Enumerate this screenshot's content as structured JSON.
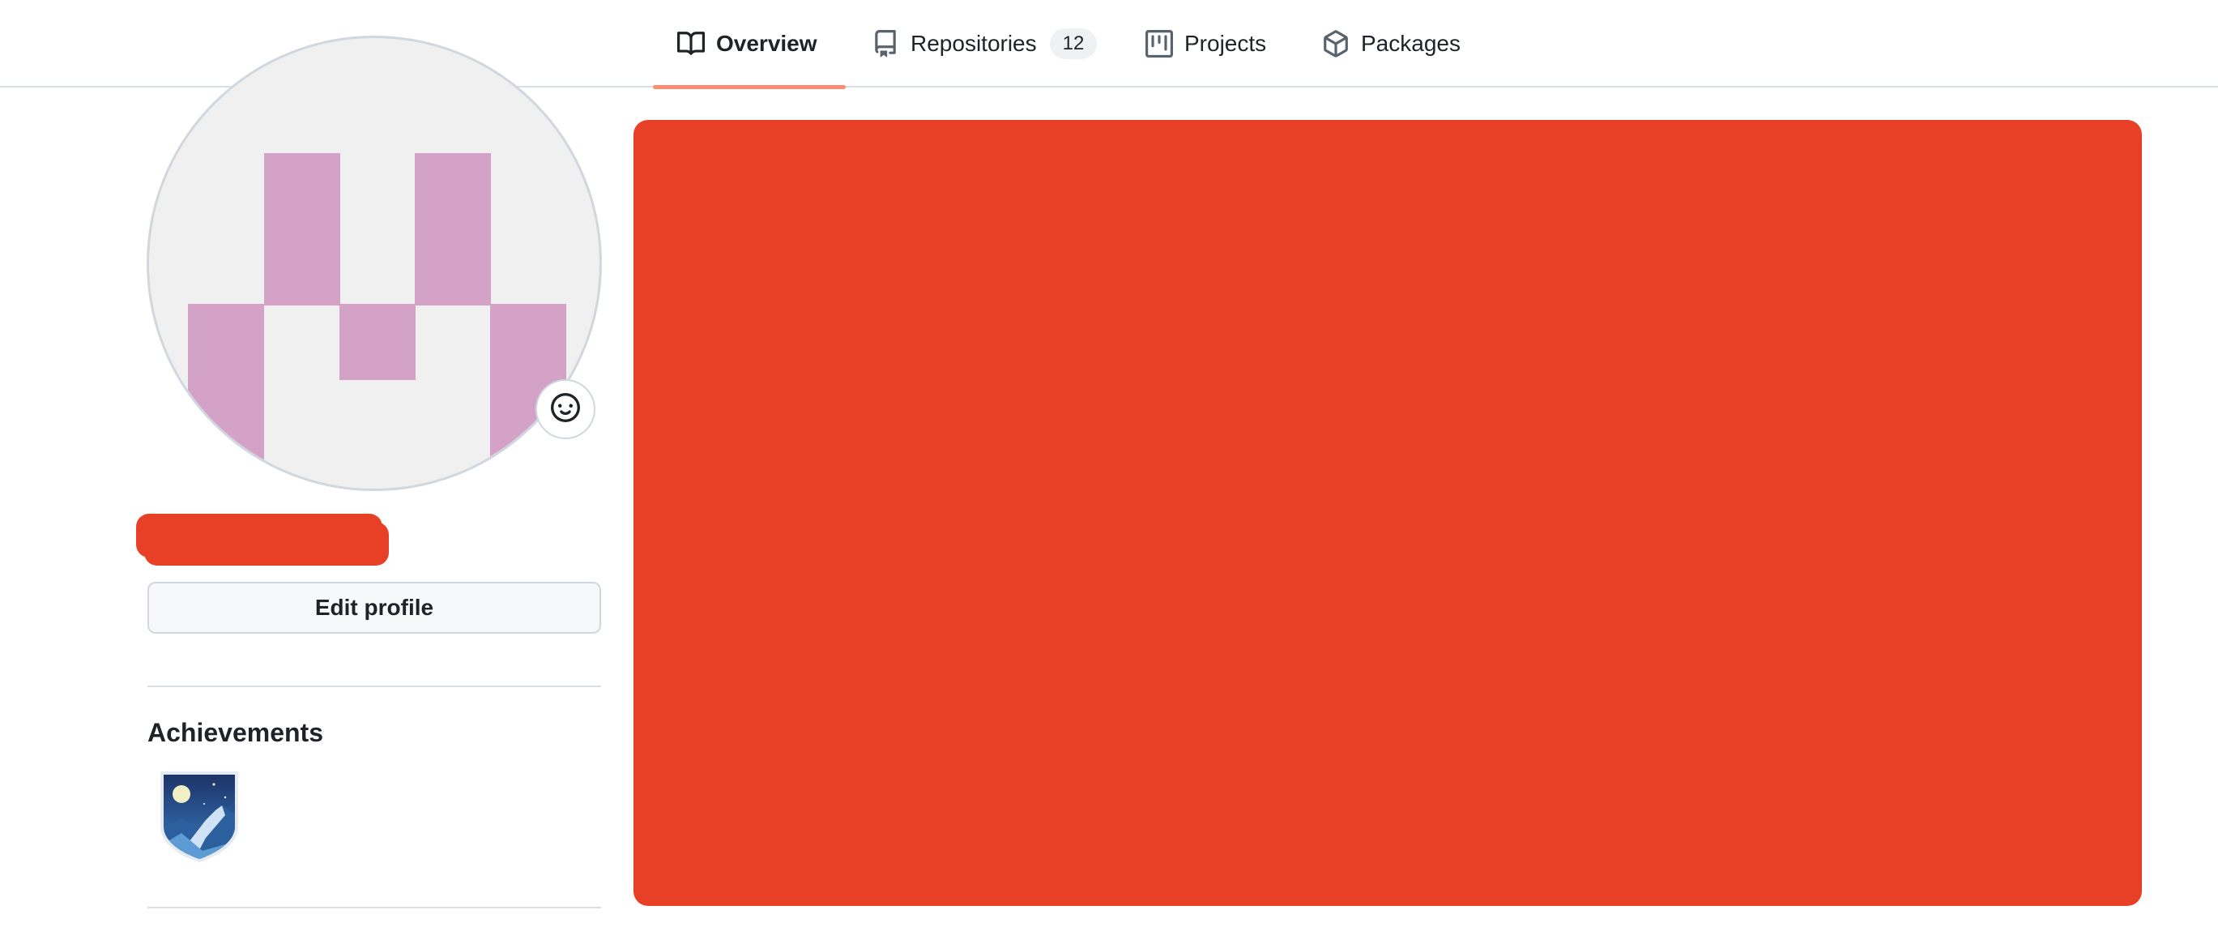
{
  "nav": {
    "tabs": [
      {
        "label": "Overview",
        "icon": "book-icon",
        "active": true
      },
      {
        "label": "Repositories",
        "icon": "repo-icon",
        "count": "12"
      },
      {
        "label": "Projects",
        "icon": "project-icon"
      },
      {
        "label": "Packages",
        "icon": "package-icon"
      }
    ],
    "active_underline_color": "#fd8c73"
  },
  "profile": {
    "avatar_colors": {
      "background": "#f0f0f0",
      "pattern": "#d4a1c7"
    },
    "status_icon": "smiley-icon",
    "name_redaction_color": "#e84026",
    "edit_button_label": "Edit profile"
  },
  "achievements": {
    "title": "Achievements",
    "badges": [
      {
        "icon": "achievement-badge-icon"
      }
    ]
  },
  "main": {
    "redaction_color": "#e84026"
  }
}
